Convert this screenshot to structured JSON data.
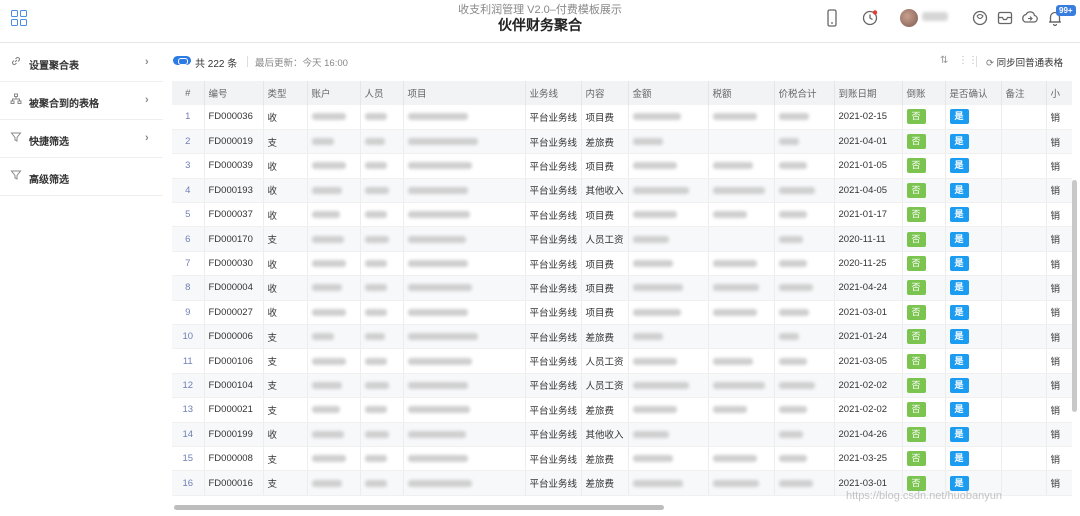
{
  "header": {
    "subtitle": "收支利润管理 V2.0–付费模板展示",
    "title": "伙伴财务聚合",
    "notification_badge": "99+"
  },
  "sidebar": {
    "items": [
      {
        "label": "设置聚合表",
        "icon": "link-icon",
        "chevron": true
      },
      {
        "label": "被聚合到的表格",
        "icon": "hierarchy-icon",
        "chevron": true
      },
      {
        "label": "快捷筛选",
        "icon": "filter-icon",
        "chevron": true
      },
      {
        "label": "高级筛选",
        "icon": "filter-icon",
        "chevron": false
      }
    ]
  },
  "toolbar": {
    "count_text": "共 222 条",
    "update_text": "最后更新：今天 16:00",
    "sync_label": "同步回普通表格"
  },
  "table": {
    "columns": [
      "#",
      "编号",
      "类型",
      "账户",
      "人员",
      "项目",
      "业务线",
      "内容",
      "金额",
      "税额",
      "价税合计",
      "到账日期",
      "倒账",
      "是否确认",
      "备注",
      "小"
    ],
    "rows": [
      {
        "n": "1",
        "id": "FD000036",
        "type": "收",
        "line": "平台业务线",
        "content": "项目费",
        "date": "2021-02-15",
        "rev": "否",
        "ok": "是",
        "tail": "销"
      },
      {
        "n": "2",
        "id": "FD000019",
        "type": "支",
        "line": "平台业务线",
        "content": "差旅费",
        "date": "2021-04-01",
        "rev": "否",
        "ok": "是",
        "tail": "销"
      },
      {
        "n": "3",
        "id": "FD000039",
        "type": "收",
        "line": "平台业务线",
        "content": "项目费",
        "date": "2021-01-05",
        "rev": "否",
        "ok": "是",
        "tail": "销"
      },
      {
        "n": "4",
        "id": "FD000193",
        "type": "收",
        "line": "平台业务线",
        "content": "其他收入",
        "date": "2021-04-05",
        "rev": "否",
        "ok": "是",
        "tail": "销"
      },
      {
        "n": "5",
        "id": "FD000037",
        "type": "收",
        "line": "平台业务线",
        "content": "项目费",
        "date": "2021-01-17",
        "rev": "否",
        "ok": "是",
        "tail": "销"
      },
      {
        "n": "6",
        "id": "FD000170",
        "type": "支",
        "line": "平台业务线",
        "content": "人员工资",
        "date": "2020-11-11",
        "rev": "否",
        "ok": "是",
        "tail": "销"
      },
      {
        "n": "7",
        "id": "FD000030",
        "type": "收",
        "line": "平台业务线",
        "content": "项目费",
        "date": "2020-11-25",
        "rev": "否",
        "ok": "是",
        "tail": "销"
      },
      {
        "n": "8",
        "id": "FD000004",
        "type": "收",
        "line": "平台业务线",
        "content": "项目费",
        "date": "2021-04-24",
        "rev": "否",
        "ok": "是",
        "tail": "销"
      },
      {
        "n": "9",
        "id": "FD000027",
        "type": "收",
        "line": "平台业务线",
        "content": "项目费",
        "date": "2021-03-01",
        "rev": "否",
        "ok": "是",
        "tail": "销"
      },
      {
        "n": "10",
        "id": "FD000006",
        "type": "支",
        "line": "平台业务线",
        "content": "差旅费",
        "date": "2021-01-24",
        "rev": "否",
        "ok": "是",
        "tail": "销"
      },
      {
        "n": "11",
        "id": "FD000106",
        "type": "支",
        "line": "平台业务线",
        "content": "人员工资",
        "date": "2021-03-05",
        "rev": "否",
        "ok": "是",
        "tail": "销"
      },
      {
        "n": "12",
        "id": "FD000104",
        "type": "支",
        "line": "平台业务线",
        "content": "人员工资",
        "date": "2021-02-02",
        "rev": "否",
        "ok": "是",
        "tail": "销"
      },
      {
        "n": "13",
        "id": "FD000021",
        "type": "支",
        "line": "平台业务线",
        "content": "差旅费",
        "date": "2021-02-02",
        "rev": "否",
        "ok": "是",
        "tail": "销"
      },
      {
        "n": "14",
        "id": "FD000199",
        "type": "收",
        "line": "平台业务线",
        "content": "其他收入",
        "date": "2021-04-26",
        "rev": "否",
        "ok": "是",
        "tail": "销"
      },
      {
        "n": "15",
        "id": "FD000008",
        "type": "支",
        "line": "平台业务线",
        "content": "差旅费",
        "date": "2021-03-25",
        "rev": "否",
        "ok": "是",
        "tail": "销"
      },
      {
        "n": "16",
        "id": "FD000016",
        "type": "支",
        "line": "平台业务线",
        "content": "差旅费",
        "date": "2021-03-01",
        "rev": "否",
        "ok": "是",
        "tail": "销"
      }
    ]
  },
  "watermark": "https://blog.csdn.net/huobanyun"
}
